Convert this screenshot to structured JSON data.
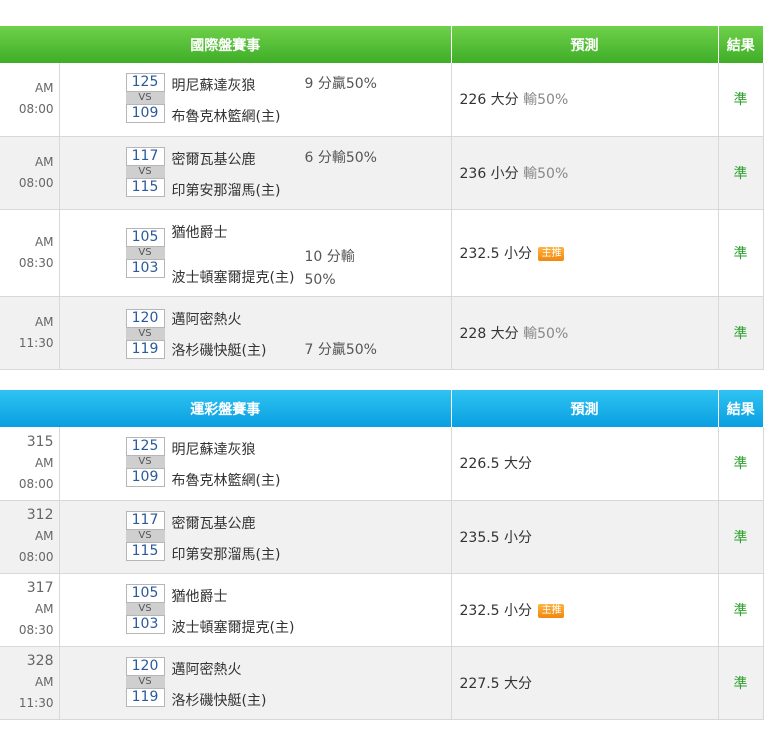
{
  "international": {
    "headers": {
      "match": "國際盤賽事",
      "prediction": "預測",
      "result": "結果"
    },
    "rows": [
      {
        "time": "AM 08:00",
        "away_score": "125",
        "home_score": "109",
        "away_team": "明尼蘇達灰狼",
        "home_team": "布魯克林籃網(主)",
        "note": "9 分贏50%",
        "prediction": "226 大分",
        "pred_sub": "輸50%",
        "badge": "",
        "result": "準"
      },
      {
        "time": "AM 08:00",
        "away_score": "117",
        "home_score": "115",
        "away_team": "密爾瓦基公鹿",
        "home_team": "印第安那溜馬(主)",
        "note": "6 分輸50%",
        "prediction": "236 小分",
        "pred_sub": "輸50%",
        "badge": "",
        "result": "準"
      },
      {
        "time": "AM 08:30",
        "away_score": "105",
        "home_score": "103",
        "away_team": "猶他爵士",
        "home_team": "波士頓塞爾提克(主)",
        "note_line1": "10 分輸",
        "note_line2": "50%",
        "prediction": "232.5 小分",
        "pred_sub": "",
        "badge": "主推",
        "result": "準"
      },
      {
        "time": "AM 11:30",
        "away_score": "120",
        "home_score": "119",
        "away_team": "邁阿密熱火",
        "home_team": "洛杉磯快艇(主)",
        "note": "7 分贏50%",
        "prediction": "228 大分",
        "pred_sub": "輸50%",
        "badge": "",
        "result": "準"
      }
    ]
  },
  "lottery": {
    "headers": {
      "match": "運彩盤賽事",
      "prediction": "預測",
      "result": "結果"
    },
    "rows": [
      {
        "code": "315",
        "time": "AM 08:00",
        "away_score": "125",
        "home_score": "109",
        "away_team": "明尼蘇達灰狼",
        "home_team": "布魯克林籃網(主)",
        "prediction": "226.5 大分",
        "badge": "",
        "result": "準"
      },
      {
        "code": "312",
        "time": "AM 08:00",
        "away_score": "117",
        "home_score": "115",
        "away_team": "密爾瓦基公鹿",
        "home_team": "印第安那溜馬(主)",
        "prediction": "235.5 小分",
        "badge": "",
        "result": "準"
      },
      {
        "code": "317",
        "time": "AM 08:30",
        "away_score": "105",
        "home_score": "103",
        "away_team": "猶他爵士",
        "home_team": "波士頓塞爾提克(主)",
        "prediction": "232.5 小分",
        "badge": "主推",
        "result": "準"
      },
      {
        "code": "328",
        "time": "AM 11:30",
        "away_score": "120",
        "home_score": "119",
        "away_team": "邁阿密熱火",
        "home_team": "洛杉磯快艇(主)",
        "prediction": "227.5 大分",
        "badge": "",
        "result": "準"
      }
    ]
  },
  "colors": {
    "intl_header": "#4cb82f",
    "lottery_header": "#16aae6",
    "result_text": "#2aa02a",
    "badge": "#f39a1f"
  }
}
